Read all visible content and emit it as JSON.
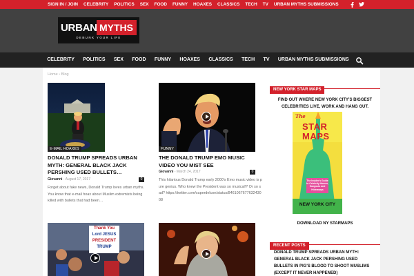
{
  "topbar": {
    "links": [
      "SIGN IN / JOIN",
      "CELEBRITY",
      "POLITICS",
      "SEX",
      "FOOD",
      "FUNNY",
      "HOAXES",
      "CLASSICS",
      "TECH",
      "TV",
      "URBAN MYTHS SUBMISSIONS"
    ],
    "social_icons": [
      "facebook-icon",
      "twitter-icon"
    ]
  },
  "logo": {
    "word1": "URBAN",
    "word2": "MYTHS",
    "tagline": "DEBUNK YOUR LIFE"
  },
  "nav": {
    "items": [
      "CELEBRITY",
      "POLITICS",
      "SEX",
      "FOOD",
      "FUNNY",
      "HOAXES",
      "CLASSICS",
      "TECH",
      "TV",
      "URBAN MYTHS SUBMISSIONS"
    ],
    "search_icon": "search-icon"
  },
  "breadcrumb": {
    "home": "Home",
    "separator": "›",
    "current": "Blog"
  },
  "posts": [
    {
      "category": "E-MAIL HOAXES",
      "title": "DONALD TRUMP SPREADS URBAN MYTH: GENERAL BLACK JACK PERSHING USED BULLETS…",
      "author": "Giovanni",
      "date": "August 17, 2017",
      "comments": "0",
      "excerpt": "Forget about fake news, Donald Trump loves urban myths. You know that e-mail hoax about Muslim extremists being killed with bullets that had been…",
      "has_video": false
    },
    {
      "category": "FUNNY",
      "title": "THE DONALD TRUMP EMO MUSIC VIDEO YOU MIST SEE",
      "author": "Giovanni",
      "date": "March 24, 2017",
      "comments": "0",
      "excerpt": "This hilarious Donald Trump early 2000's Emo music video is pure genius. Who knew the President was so musical!? Or so sad? https://twitter.com/superdeluxe/status/846106767763243008",
      "has_video": true
    },
    {
      "category": "",
      "title": "",
      "author": "",
      "date": "",
      "comments": "",
      "excerpt": "",
      "has_video": true,
      "sign_lines": [
        "Thank You",
        "Lord JESUS",
        "PRESIDENT",
        "TRUMP"
      ]
    },
    {
      "category": "",
      "title": "",
      "author": "",
      "date": "",
      "comments": "",
      "excerpt": "",
      "has_video": true
    }
  ],
  "sidebar": {
    "widget1_title": "NEW YORK STAR MAPS",
    "widget1_text": "FIND OUT WHERE NEW YORK CITY'S BIGGEST CELEBRITIES LIVE, WORK AND HANG OUT.",
    "book": {
      "top": "The",
      "title1": "STAR",
      "title2": "MAPS",
      "subtitle": "The Insider's Guide to Celebrity Homes, Hangouts and Hideaways",
      "city": "NEW YORK CITY"
    },
    "widget1_link": "DOWNLOAD NY STARMAPS",
    "widget2_title": "RECENT POSTS",
    "recent_posts": [
      "DONALD TRUMP SPREADS URBAN MYTH: GENERAL BLACK JACK PERSHING USED BULLETS IN PIG'S BLOOD TO SHOOT MUSLIMS (EXCEPT IT NEVER HAPPENED)"
    ]
  },
  "colors": {
    "brand_red": "#d3212b",
    "nav_dark": "#222222",
    "header_gray": "#414141"
  }
}
